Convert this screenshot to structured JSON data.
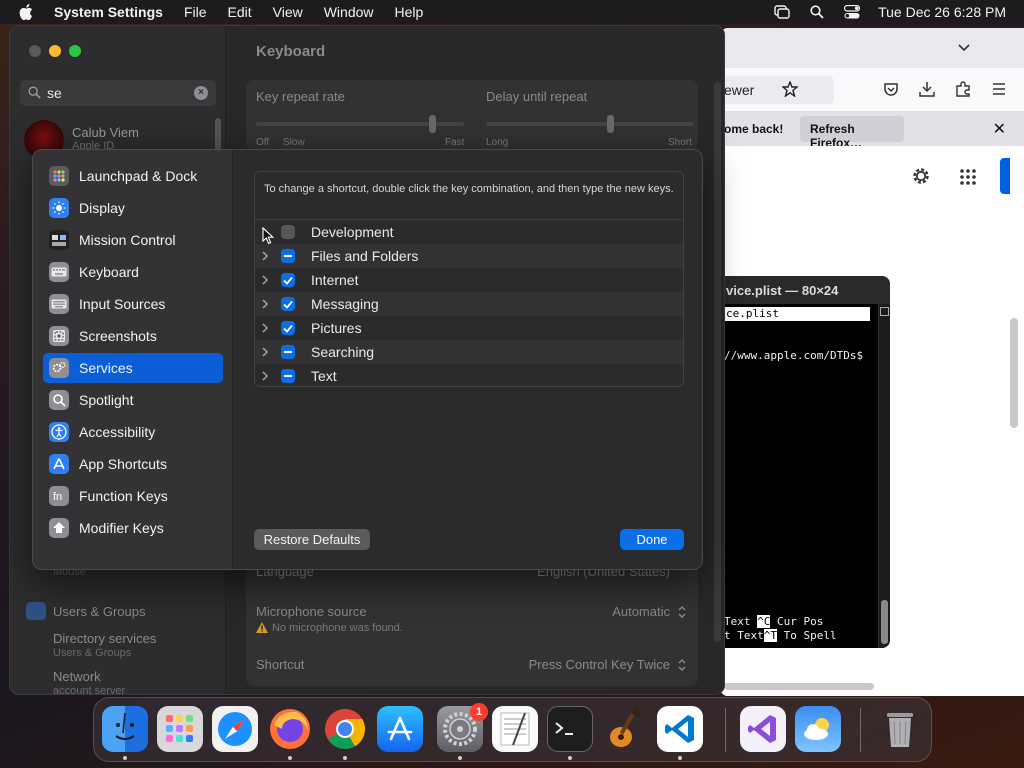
{
  "menubar": {
    "app_name": "System Settings",
    "items": [
      "File",
      "Edit",
      "View",
      "Window",
      "Help"
    ],
    "clock": "Tue Dec 26  6:28 PM"
  },
  "firefox": {
    "url_fragment": "ewer",
    "notice_text": "ome back!",
    "notice_button": "Refresh Firefox…",
    "notice_close": "✕"
  },
  "terminal": {
    "title": "vice.plist — 80×24",
    "field": "ce.plist",
    "line1": "//www.apple.com/DTDs$",
    "line2a": "Text ",
    "line2_key": "^C",
    "line2b": " Cur Pos",
    "line3a": "t Text",
    "line3_key": "^T",
    "line3b": " To Spell"
  },
  "settings": {
    "search_value": "se",
    "user_name": "Calub Viem",
    "user_sub": "Apple ID",
    "window_title": "Keyboard",
    "key_repeat_label": "Key repeat rate",
    "delay_label": "Delay until repeat",
    "off": "Off",
    "slow": "Slow",
    "fast": "Fast",
    "long": "Long",
    "short": "Short",
    "mouse_label": "Mouse",
    "users_groups": "Users & Groups",
    "directory_services": "Directory services",
    "directory_sub": "Users & Groups",
    "network": "Network",
    "network_sub": "account server",
    "language_label": "Language",
    "language_value": "English (United States)",
    "mic_label": "Microphone source",
    "mic_value": "Automatic",
    "mic_warning": "No microphone was found.",
    "shortcut_label": "Shortcut",
    "shortcut_value": "Press Control Key Twice"
  },
  "sheet": {
    "categories": [
      {
        "label": "Launchpad & Dock",
        "icon": "launchpad-dock-icon",
        "color": "#5b5b60"
      },
      {
        "label": "Display",
        "icon": "display-icon",
        "color": "#2f7ef6"
      },
      {
        "label": "Mission Control",
        "icon": "mission-control-icon",
        "color": "#222222"
      },
      {
        "label": "Keyboard",
        "icon": "keyboard-icon",
        "color": "#8e8e93"
      },
      {
        "label": "Input Sources",
        "icon": "input-sources-icon",
        "color": "#8e8e93"
      },
      {
        "label": "Screenshots",
        "icon": "screenshots-icon",
        "color": "#8e8e93"
      },
      {
        "label": "Services",
        "icon": "services-icon",
        "color": "#8e8e93"
      },
      {
        "label": "Spotlight",
        "icon": "spotlight-icon",
        "color": "#8e8e93"
      },
      {
        "label": "Accessibility",
        "icon": "accessibility-icon",
        "color": "#2f7ef6"
      },
      {
        "label": "App Shortcuts",
        "icon": "app-shortcuts-icon",
        "color": "#2f7ef6"
      },
      {
        "label": "Function Keys",
        "icon": "function-keys-icon",
        "color": "#8e8e93"
      },
      {
        "label": "Modifier Keys",
        "icon": "modifier-keys-icon",
        "color": "#8e8e93"
      }
    ],
    "selected_category": "Services",
    "help_text": "To change a shortcut, double click the key combination, and then type the new keys.",
    "services": [
      {
        "name": "Development",
        "state": "unchecked"
      },
      {
        "name": "Files and Folders",
        "state": "mixed"
      },
      {
        "name": "Internet",
        "state": "checked"
      },
      {
        "name": "Messaging",
        "state": "checked"
      },
      {
        "name": "Pictures",
        "state": "checked"
      },
      {
        "name": "Searching",
        "state": "mixed"
      },
      {
        "name": "Text",
        "state": "mixed"
      }
    ],
    "restore_label": "Restore Defaults",
    "done_label": "Done"
  },
  "dock": {
    "apps": [
      "Finder",
      "Launchpad",
      "Safari",
      "Firefox",
      "Chrome",
      "App Store",
      "System Settings",
      "TextEdit",
      "Terminal",
      "GarageBand",
      "Visual Studio Code",
      "Visual Studio",
      "Weather",
      "Trash"
    ],
    "settings_badge": "1"
  },
  "colors": {
    "accent": "#0a6ee8",
    "selection": "#0a5fd6"
  }
}
